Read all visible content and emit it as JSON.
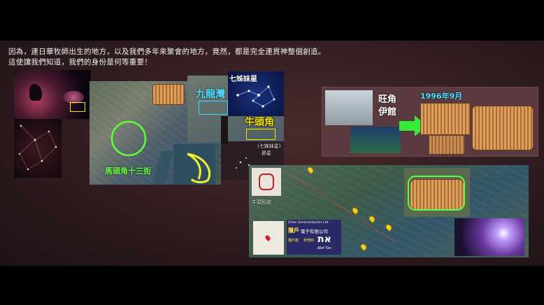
{
  "caption": {
    "line1": "因為，連日華牧師出生的地方，以及我們多年來聚會的地方，竟然，都是完全連貫神整個創造。",
    "line2": "這使讓我們知道，我們的身份是何等重要！"
  },
  "map_main": {
    "label_kowloon_bay": "九龍灣",
    "label_seven_sisters": "七姊妹星",
    "label_ngau_tau_kok": "牛頭角",
    "label_ma_tau_kok": "馬頭角十三街",
    "label_pleiades_small": "(七姊妹星)",
    "label_pleiades_small2": "昴星"
  },
  "panel_mongkok": {
    "label_place": "旺角",
    "label_place2": "伊館",
    "label_date": "1996年9月"
  },
  "panel_route": {
    "label_ox_shape": "牛頭形狀",
    "orion_en": "Orion Semiconductor Ltd",
    "orion_zh1": "獵戶",
    "orion_zh2": "電子有限公司",
    "orion_sub1": "獵戶座",
    "orion_sub2": "參宿四",
    "aleph_tav": "Alef Tav",
    "aleph_glyph": "את"
  },
  "colors": {
    "accent_yellow": "#f5e300",
    "accent_cyan": "#3fd6ff",
    "accent_green": "#6cff4a",
    "background": "#2f1c1f"
  }
}
